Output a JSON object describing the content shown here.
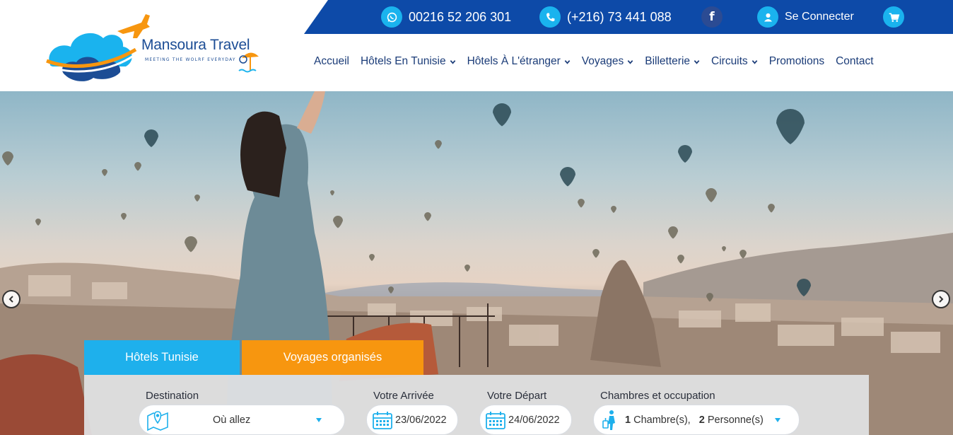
{
  "header": {
    "logo": {
      "brand": "Mansoura Travel",
      "tagline": "MEETING THE WOLRF EVERYDAY"
    },
    "topbar": {
      "whatsapp": "00216 52 206 301",
      "phone": "(+216) 73 441 088",
      "facebook_icon": "facebook-icon",
      "login": "Se Connecter",
      "cart_icon": "cart-icon"
    },
    "nav": [
      {
        "label": "Accueil",
        "dropdown": false
      },
      {
        "label": "Hôtels En Tunisie",
        "dropdown": true
      },
      {
        "label": "Hôtels À L'étranger",
        "dropdown": true
      },
      {
        "label": "Voyages",
        "dropdown": true
      },
      {
        "label": "Billetterie",
        "dropdown": true
      },
      {
        "label": "Circuits",
        "dropdown": true
      },
      {
        "label": "Promotions",
        "dropdown": false
      },
      {
        "label": "Contact",
        "dropdown": false
      }
    ]
  },
  "colors": {
    "topbar": "#0d4aa8",
    "accent_blue": "#1eb0ec",
    "accent_orange": "#f7960f",
    "nav_text": "#1b3c78"
  },
  "search": {
    "tabs": [
      {
        "label": "Hôtels Tunisie",
        "active": true
      },
      {
        "label": "Voyages organisés",
        "active": false
      }
    ],
    "destination": {
      "label": "Destination",
      "value": "Où allez"
    },
    "arrival": {
      "label": "Votre Arrivée",
      "value": "23/06/2022"
    },
    "departure": {
      "label": "Votre Départ",
      "value": "24/06/2022"
    },
    "occupancy": {
      "label": "Chambres et occupation",
      "rooms": "1",
      "rooms_label": "Chambre(s),",
      "persons": "2",
      "persons_label": "Personne(s)"
    }
  }
}
